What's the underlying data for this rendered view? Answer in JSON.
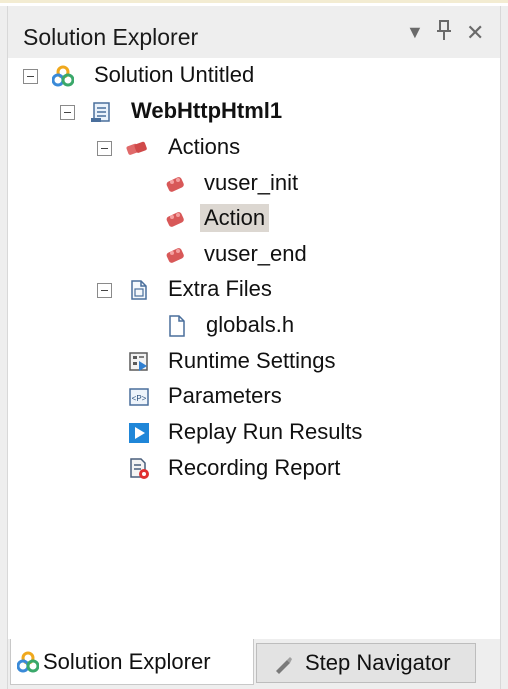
{
  "panel": {
    "title": "Solution Explorer",
    "dropdown_icon": "▾",
    "pin_icon": "ྶ",
    "close_icon": "✕"
  },
  "tree": {
    "solution": "Solution Untitled",
    "script": "WebHttpHtml1",
    "actions": "Actions",
    "vuser_init": "vuser_init",
    "action": "Action",
    "vuser_end": "vuser_end",
    "extra_files": "Extra Files",
    "globals": "globals.h",
    "runtime_settings": "Runtime Settings",
    "parameters": "Parameters",
    "replay_results": "Replay Run Results",
    "recording_report": "Recording Report"
  },
  "tabs": {
    "solution_explorer": "Solution Explorer",
    "step_navigator": "Step Navigator"
  }
}
